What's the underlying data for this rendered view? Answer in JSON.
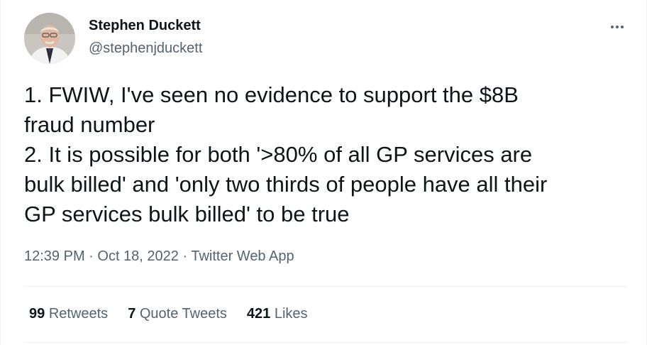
{
  "author": {
    "display_name": "Stephen Duckett",
    "handle": "@stephenjduckett"
  },
  "tweet": {
    "lines": [
      "1. FWIW, I've seen no evidence to support the $8B",
      "fraud number",
      "2. It is possible for both '>80% of all GP services are",
      "bulk billed' and 'only two thirds of people have all their",
      "GP services bulk billed' to be true"
    ]
  },
  "meta": {
    "time": "12:39 PM",
    "date": "Oct 18, 2022",
    "source": "Twitter Web App",
    "separator": " · "
  },
  "stats": {
    "retweets_count": "99",
    "retweets_label": "Retweets",
    "quotes_count": "7",
    "quotes_label": "Quote Tweets",
    "likes_count": "421",
    "likes_label": "Likes"
  },
  "icons": {
    "more": "more-horizontal-icon",
    "avatar": "profile-photo"
  },
  "colors": {
    "text_primary": "#0f1419",
    "text_secondary": "#536471",
    "divider": "#eff3f4"
  }
}
